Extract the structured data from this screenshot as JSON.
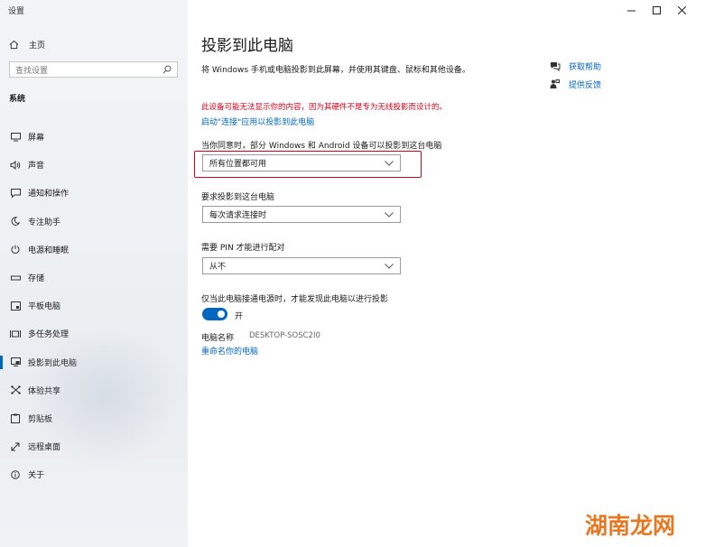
{
  "app": {
    "title": "设置"
  },
  "sidebar": {
    "home_label": "主页",
    "search_placeholder": "查找设置",
    "section": "系统",
    "items": [
      {
        "label": "屏幕",
        "icon": "monitor-icon"
      },
      {
        "label": "声音",
        "icon": "speaker-icon"
      },
      {
        "label": "通知和操作",
        "icon": "notification-icon"
      },
      {
        "label": "专注助手",
        "icon": "moon-icon"
      },
      {
        "label": "电源和睡眠",
        "icon": "power-icon"
      },
      {
        "label": "存储",
        "icon": "storage-icon"
      },
      {
        "label": "平板电脑",
        "icon": "tablet-icon"
      },
      {
        "label": "多任务处理",
        "icon": "multitask-icon"
      },
      {
        "label": "投影到此电脑",
        "icon": "project-icon",
        "active": true
      },
      {
        "label": "体验共享",
        "icon": "share-icon"
      },
      {
        "label": "剪贴板",
        "icon": "clipboard-icon"
      },
      {
        "label": "远程桌面",
        "icon": "remote-desktop-icon"
      },
      {
        "label": "关于",
        "icon": "info-icon"
      }
    ]
  },
  "main": {
    "title": "投影到此电脑",
    "description": "将 Windows 手机或电脑投影到此屏幕，并使用其键盘、鼠标和其他设备。",
    "warning": "此设备可能无法显示你的内容，因为其硬件不是专为无线投影而设计的。",
    "enable_link": "启动\"连接\"应用以投影到此电脑",
    "availability": {
      "label": "当你同意时，部分 Windows 和 Android 设备可以投影到这台电脑",
      "value": "所有位置都可用"
    },
    "ask": {
      "label": "要求投影到这台电脑",
      "value": "每次请求连接时"
    },
    "pin": {
      "label": "需要 PIN 才能进行配对",
      "value": "从不"
    },
    "power": {
      "label": "仅当此电脑接通电源时，才能发现此电脑以进行投影",
      "toggle_state": "开",
      "on": true
    },
    "pc_name_label": "电脑名称",
    "pc_name_value": "DESKTOP-SOSC2I0",
    "rename_link": "重命名你的电脑"
  },
  "help": {
    "get_help": "获取帮助",
    "feedback": "提供反馈"
  },
  "watermark": "湖南龙网",
  "colors": {
    "accent": "#0067c0",
    "warning": "#d0021b",
    "watermark": "#e87722"
  }
}
